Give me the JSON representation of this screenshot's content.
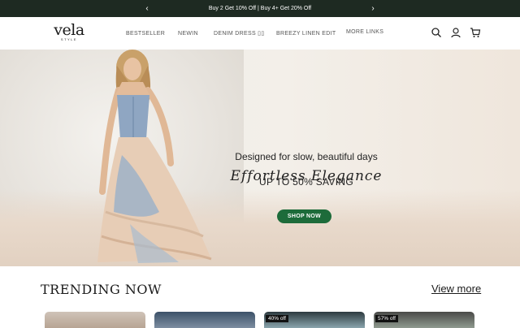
{
  "promo": {
    "text": "Buy 2 Get 10% Off | Buy 4+ Get 20% Off",
    "prev_icon": "chevron-left-icon",
    "next_icon": "chevron-right-icon"
  },
  "brand": {
    "name": "vela",
    "tagline": "STYLE"
  },
  "nav": {
    "items": [
      {
        "label": "BESTSELLER"
      },
      {
        "label": "NEWIN"
      },
      {
        "label": "DENIM DRESS ▯▯"
      },
      {
        "label": "BREEZY LINEN EDIT"
      },
      {
        "label": "MORE LINKS"
      }
    ]
  },
  "header_icons": [
    "search-icon",
    "account-icon",
    "cart-icon"
  ],
  "hero": {
    "title": "Effortless Elegance",
    "subtitle": "Designed for slow, beautiful days",
    "saving": "UP TO 50% SAVING",
    "cta": "SHOP NOW",
    "cta_color": "#1d6b3a"
  },
  "trending": {
    "title": "TRENDING NOW",
    "view_more": "View more",
    "cards": [
      {
        "badge": ""
      },
      {
        "badge": ""
      },
      {
        "badge": "40% off"
      },
      {
        "badge": "57% off"
      }
    ]
  },
  "colors": {
    "promo_bg": "#1e2a22",
    "accent": "#1d6b3a"
  }
}
